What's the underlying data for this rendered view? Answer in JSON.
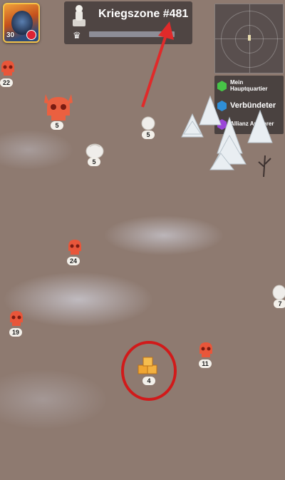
{
  "player": {
    "level": "30",
    "icon": "player-portrait-icon"
  },
  "zone": {
    "title": "Kriegszone #481",
    "statue_icon": "statue-icon",
    "crown_icon": "crown-icon"
  },
  "minimap": {
    "icon": "minimap"
  },
  "legend": {
    "items": [
      {
        "label_line1": "Mein",
        "label_line2": "Hauptquartier",
        "color": "#47c447"
      },
      {
        "label_line1": "Verbündeter",
        "label_line2": "",
        "color": "#2f8fd8"
      },
      {
        "label_line1": "Allianz Anführer",
        "label_line2": "",
        "color": "#9a46d8"
      }
    ]
  },
  "map": {
    "markers": [
      {
        "type": "skull",
        "level": "22"
      },
      {
        "type": "horned-skull",
        "level": "5"
      },
      {
        "type": "white-node",
        "level": "5"
      },
      {
        "type": "white-node",
        "level": "5"
      },
      {
        "type": "skull",
        "level": "24"
      },
      {
        "type": "white-node",
        "level": "7"
      },
      {
        "type": "skull",
        "level": "19"
      },
      {
        "type": "skull",
        "level": "11"
      },
      {
        "type": "gold-crates",
        "level": "4"
      }
    ]
  },
  "annotation": {
    "arrow_color": "#e02a2a",
    "circle_color": "#d11a1a"
  },
  "colors": {
    "enemy": "#e8563a",
    "gold": "#f0a531"
  }
}
